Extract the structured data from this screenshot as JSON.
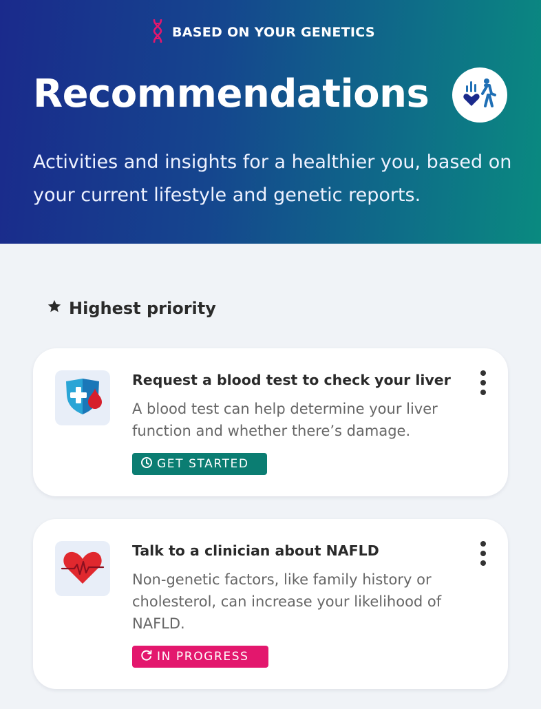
{
  "header": {
    "eyebrow": "BASED ON YOUR GENETICS",
    "eyebrow_icon": "dna-icon",
    "title": "Recommendations",
    "badge_icon": "activity-heart-icon",
    "subtitle": "Activities and insights for a healthier you, based on your current lifestyle and genetic reports."
  },
  "section": {
    "icon": "star-icon",
    "title": "Highest priority"
  },
  "cards": [
    {
      "icon": "shield-blood-drop-icon",
      "title": "Request a blood test to check your liver",
      "body": "A blood test can help determine your liver function and whether there’s damage.",
      "status": "GET STARTED",
      "status_icon": "clock-icon",
      "status_color": "#0b7d72"
    },
    {
      "icon": "heart-pulse-icon",
      "title": "Talk to a clinician about NAFLD",
      "body": "Non-genetic factors, like family history or cholesterol, can increase your likelihood of NAFLD.",
      "status": "IN PROGRESS",
      "status_icon": "progress-icon",
      "status_color": "#e3176d"
    }
  ],
  "colors": {
    "hero_start": "#1a2a8c",
    "hero_end": "#0a8a80",
    "accent_pink": "#e3176d",
    "accent_green": "#0b7d72"
  }
}
